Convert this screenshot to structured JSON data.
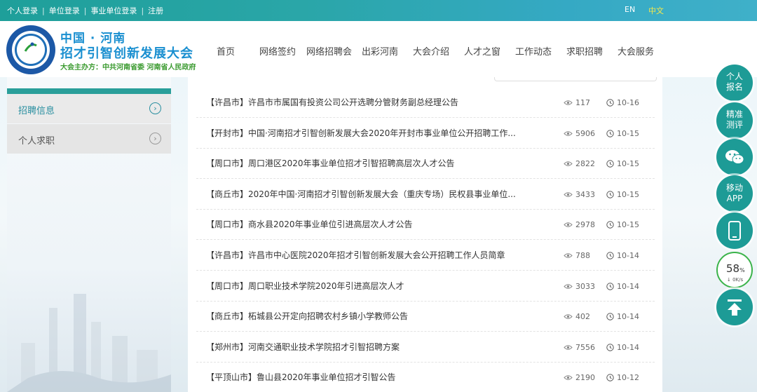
{
  "topbar": {
    "links": [
      "个人登录",
      "单位登录",
      "事业单位登录",
      "注册"
    ],
    "lang_en": "EN",
    "lang_zh": "中文"
  },
  "header": {
    "title_line1": "中国 · 河南",
    "title_line2": "招才引智创新发展大会",
    "subtitle": "大会主办方：中共河南省委 河南省人民政府"
  },
  "nav": [
    "首页",
    "网络签约",
    "网络招聘会",
    "出彩河南",
    "大会介绍",
    "人才之窗",
    "工作动态",
    "求职招聘",
    "大会服务"
  ],
  "sidebar": {
    "items": [
      {
        "label": "招聘信息",
        "active": true
      },
      {
        "label": "个人求职",
        "active": false
      }
    ]
  },
  "list": [
    {
      "title": "【许昌市】许昌市市属国有投资公司公开选聘分管财务副总经理公告",
      "views": "117",
      "date": "10-16"
    },
    {
      "title": "【开封市】中国·河南招才引智创新发展大会2020年开封市事业单位公开招聘工作...",
      "views": "5906",
      "date": "10-15"
    },
    {
      "title": "【周口市】周口港区2020年事业单位招才引智招聘高层次人才公告",
      "views": "2822",
      "date": "10-15"
    },
    {
      "title": "【商丘市】2020年中国·河南招才引智创新发展大会（重庆专场）民权县事业单位...",
      "views": "3433",
      "date": "10-15"
    },
    {
      "title": "【周口市】商水县2020年事业单位引进高层次人才公告",
      "views": "2978",
      "date": "10-15"
    },
    {
      "title": "【许昌市】许昌市中心医院2020年招才引智创新发展大会公开招聘工作人员简章",
      "views": "788",
      "date": "10-14"
    },
    {
      "title": "【周口市】周口职业技术学院2020年引进高层次人才",
      "views": "3033",
      "date": "10-14"
    },
    {
      "title": "【商丘市】柘城县公开定向招聘农村乡镇小学教师公告",
      "views": "402",
      "date": "10-14"
    },
    {
      "title": "【郑州市】河南交通职业技术学院招才引智招聘方案",
      "views": "7556",
      "date": "10-14"
    },
    {
      "title": "【平顶山市】鲁山县2020年事业单位招才引智公告",
      "views": "2190",
      "date": "10-12"
    }
  ],
  "float_buttons": [
    {
      "label1": "个人",
      "label2": "报名"
    },
    {
      "label1": "精准",
      "label2": "测评"
    },
    {
      "label1": "",
      "label2": ""
    },
    {
      "label1": "移动",
      "label2": "APP"
    }
  ],
  "speed_widget": {
    "percent": "58",
    "unit": "%",
    "rate": "0K/s"
  },
  "colors": {
    "brand_teal": "#1d9b96",
    "accent_yellow": "#f6e84a",
    "logo_blue": "#1a8fd0",
    "logo_green": "#3a9a2f"
  }
}
